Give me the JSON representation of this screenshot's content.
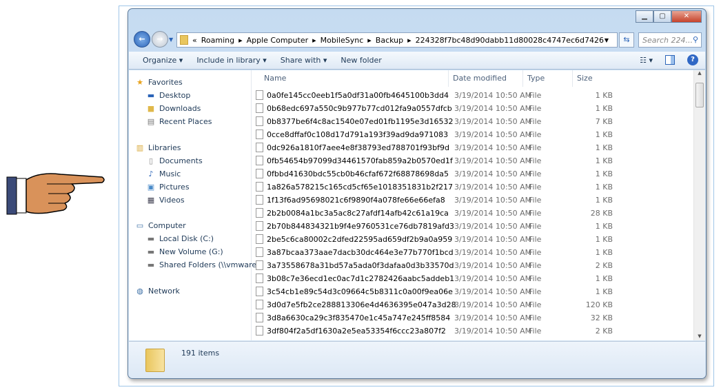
{
  "window": {
    "minimize": "▁",
    "maximize": "▢",
    "close": "✕"
  },
  "address": {
    "overflow": "«",
    "segments": [
      "Roaming",
      "Apple Computer",
      "MobileSync",
      "Backup",
      "224328f7bc48d90dabb11d80028c4747ec6d7426"
    ],
    "search_placeholder": "Search 224..."
  },
  "toolbar": {
    "organize": "Organize ▾",
    "include": "Include in library ▾",
    "share": "Share with ▾",
    "new_folder": "New folder"
  },
  "sidebar": {
    "favorites": "Favorites",
    "fav_items": [
      "Desktop",
      "Downloads",
      "Recent Places"
    ],
    "libraries": "Libraries",
    "lib_items": [
      "Documents",
      "Music",
      "Pictures",
      "Videos"
    ],
    "computer": "Computer",
    "comp_items": [
      "Local Disk (C:)",
      "New Volume (G:)",
      "Shared Folders (\\\\vmware-"
    ],
    "network": "Network"
  },
  "columns": {
    "name": "Name",
    "date": "Date modified",
    "type": "Type",
    "size": "Size"
  },
  "files": [
    {
      "name": "0a0fe145cc0eeb1f5a0df31a00fb4645100b3dd4",
      "date": "3/19/2014 10:50 AM",
      "type": "File",
      "size": "1 KB"
    },
    {
      "name": "0b68edc697a550c9b977b77cd012fa9a0557dfcb",
      "date": "3/19/2014 10:50 AM",
      "type": "File",
      "size": "1 KB"
    },
    {
      "name": "0b8377be6f4c8ac1540e07ed01fb1195e3d16532",
      "date": "3/19/2014 10:50 AM",
      "type": "File",
      "size": "7 KB"
    },
    {
      "name": "0cce8dffaf0c108d17d791a193f39ad9da971083",
      "date": "3/19/2014 10:50 AM",
      "type": "File",
      "size": "1 KB"
    },
    {
      "name": "0dc926a1810f7aee4e8f38793ed788701f93bf9d",
      "date": "3/19/2014 10:50 AM",
      "type": "File",
      "size": "1 KB"
    },
    {
      "name": "0fb54654b97099d34461570fab859a2b0570ed1f",
      "date": "3/19/2014 10:50 AM",
      "type": "File",
      "size": "1 KB"
    },
    {
      "name": "0fbbd41630bdc55cb0b46cfaf672f68878698da5",
      "date": "3/19/2014 10:50 AM",
      "type": "File",
      "size": "1 KB"
    },
    {
      "name": "1a826a578215c165cd5cf65e1018351831b2f217",
      "date": "3/19/2014 10:50 AM",
      "type": "File",
      "size": "1 KB"
    },
    {
      "name": "1f13f6ad95698021c6f9890f4a078fe66e66efa8",
      "date": "3/19/2014 10:50 AM",
      "type": "File",
      "size": "1 KB"
    },
    {
      "name": "2b2b0084a1bc3a5ac8c27afdf14afb42c61a19ca",
      "date": "3/19/2014 10:50 AM",
      "type": "File",
      "size": "28 KB"
    },
    {
      "name": "2b70b844834321b9f4e9760531ce76db7819afd3",
      "date": "3/19/2014 10:50 AM",
      "type": "File",
      "size": "1 KB"
    },
    {
      "name": "2be5c6ca80002c2dfed22595ad659df2b9a0a959",
      "date": "3/19/2014 10:50 AM",
      "type": "File",
      "size": "1 KB"
    },
    {
      "name": "3a87bcaa373aae7dacb30dc464e3e77b770f1bcd",
      "date": "3/19/2014 10:50 AM",
      "type": "File",
      "size": "1 KB"
    },
    {
      "name": "3a73558678a31bd57a5ada0f3dafaa0d3b33570d",
      "date": "3/19/2014 10:50 AM",
      "type": "File",
      "size": "2 KB"
    },
    {
      "name": "3b08c7e36ecd1ec0ac7d1c2782426aabc5addeb1",
      "date": "3/19/2014 10:50 AM",
      "type": "File",
      "size": "1 KB"
    },
    {
      "name": "3c54cb1e89c54d3c09664c5b8311c0a00f9ea06e",
      "date": "3/19/2014 10:50 AM",
      "type": "File",
      "size": "1 KB"
    },
    {
      "name": "3d0d7e5fb2ce288813306e4d4636395e047a3d28",
      "date": "3/19/2014 10:50 AM",
      "type": "File",
      "size": "120 KB"
    },
    {
      "name": "3d8a6630ca29c3f835470e1c45a747e245ff8584",
      "date": "3/19/2014 10:50 AM",
      "type": "File",
      "size": "32 KB"
    },
    {
      "name": "3df804f2a5df1630a2e5ea53354f6ccc23a807f2",
      "date": "3/19/2014 10:50 AM",
      "type": "File",
      "size": "2 KB"
    }
  ],
  "status": {
    "count": "191 items"
  }
}
